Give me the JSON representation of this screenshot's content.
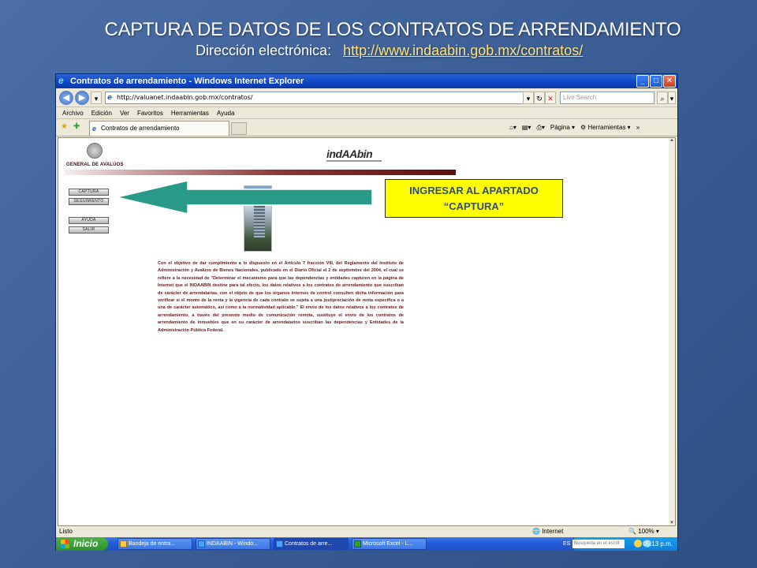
{
  "slide": {
    "title": "CAPTURA DE DATOS DE LOS CONTRATOS DE ARRENDAMIENTO",
    "subtitle_label": "Dirección electrónica:",
    "subtitle_link": "http://www.indaabin.gob.mx/contratos/"
  },
  "window": {
    "title": "Contratos de arrendamiento - Windows Internet Explorer",
    "address": "http://valuanet.indaabin.gob.mx/contratos/",
    "search_placeholder": "Live Search",
    "menu": [
      "Archivo",
      "Edición",
      "Ver",
      "Favoritos",
      "Herramientas",
      "Ayuda"
    ],
    "tab_label": "Contratos de arrendamiento",
    "toolbar_page": "Página",
    "toolbar_tools": "Herramientas"
  },
  "page": {
    "department": "GENERAL DE AVALÚOS",
    "logo": "indAAbin",
    "menu_buttons": [
      "CAPTURA",
      "SEGUIMIENTO",
      "AYUDA",
      "SALIR"
    ],
    "body_text": "Con el objetivo de dar cumplimiento a lo dispuesto en el Artículo 7 fracción VIII, del Reglamento del Instituto de Administración y Avalúos de Bienes Nacionales, publicado en el Diario Oficial el 2 de septiembre del 2004, el cual se refiere a la necesidad de \"Determinar el mecanismo para que las dependencias y entidades capturen en la página de Internet que el INDAABIN destine para tal efecto, los datos relativos a los contratos de arrendamiento que suscriban de carácter de arrendatarias, con el objeto de que los órganos internos de control consulten dicha información para verificar si el monto de la renta y la vigencia de cada contrato se sujeta a una justipreciación de renta específica o a una de carácter automático, así como a la normatividad aplicable.\" El envío de los datos relativos a los contratos de arrendamiento, a través del presente medio de comunicación remota, sustituye el envío de los contratos de arrendamiento de inmuebles que en su carácter de arrendatarios suscriban las dependencias y Entidades de la Administración Pública Federal."
  },
  "annotation": {
    "line1": "INGRESAR AL APARTADO",
    "line2": "“CAPTURA”",
    "arrow_color": "#2a9a88",
    "box_color": "#ffff00"
  },
  "status": {
    "left": "Listo",
    "zone": "Internet",
    "zoom": "100%"
  },
  "taskbar": {
    "start": "Inicio",
    "tasks": [
      "Bandeja de entra...",
      "INDAABIN - Windo...",
      "Contratos de arre...",
      "Microsoft Excel - L..."
    ],
    "lang": "ES",
    "search_placeholder": "Búsqueda en el escrit",
    "time": "05:13 p.m."
  }
}
